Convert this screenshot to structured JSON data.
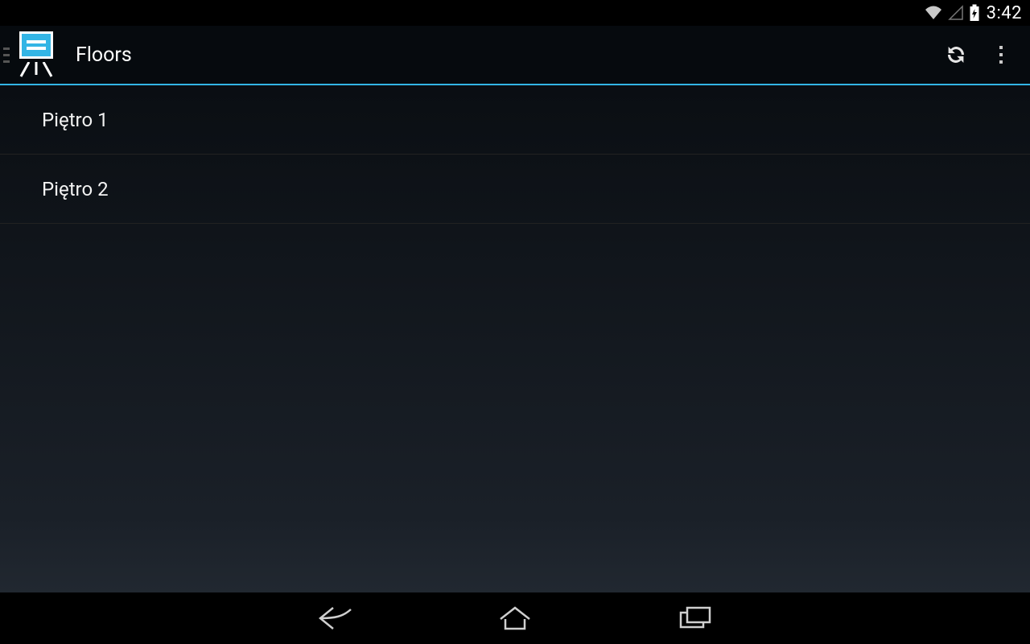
{
  "status": {
    "time": "3:42"
  },
  "header": {
    "title": "Floors"
  },
  "floors": [
    {
      "label": "Piętro 1"
    },
    {
      "label": "Piętro 2"
    }
  ],
  "colors": {
    "accent": "#33b5e5"
  }
}
